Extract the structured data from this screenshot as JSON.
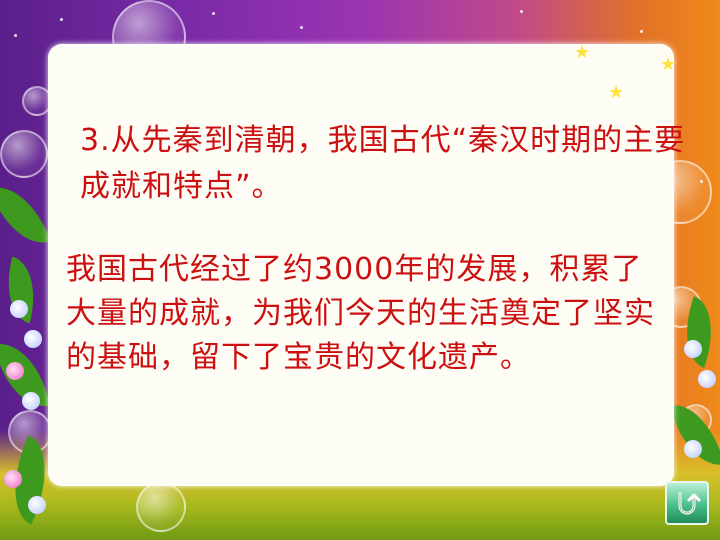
{
  "slide": {
    "heading": "3.从先秦到清朝，我国古代“秦汉时期的主要成就和特点”。",
    "paragraph": "我国古代经过了约3000年的发展，积累了大量的成就，为我们今天的生活奠定了坚实的基础，留下了宝贵的文化遗产。"
  },
  "icons": {
    "return": "return-arrow-icon",
    "decoration": "star-icon"
  },
  "colors": {
    "text": "#cc1010",
    "panel": "#fdfdf6",
    "button": "#4cbf8a"
  }
}
